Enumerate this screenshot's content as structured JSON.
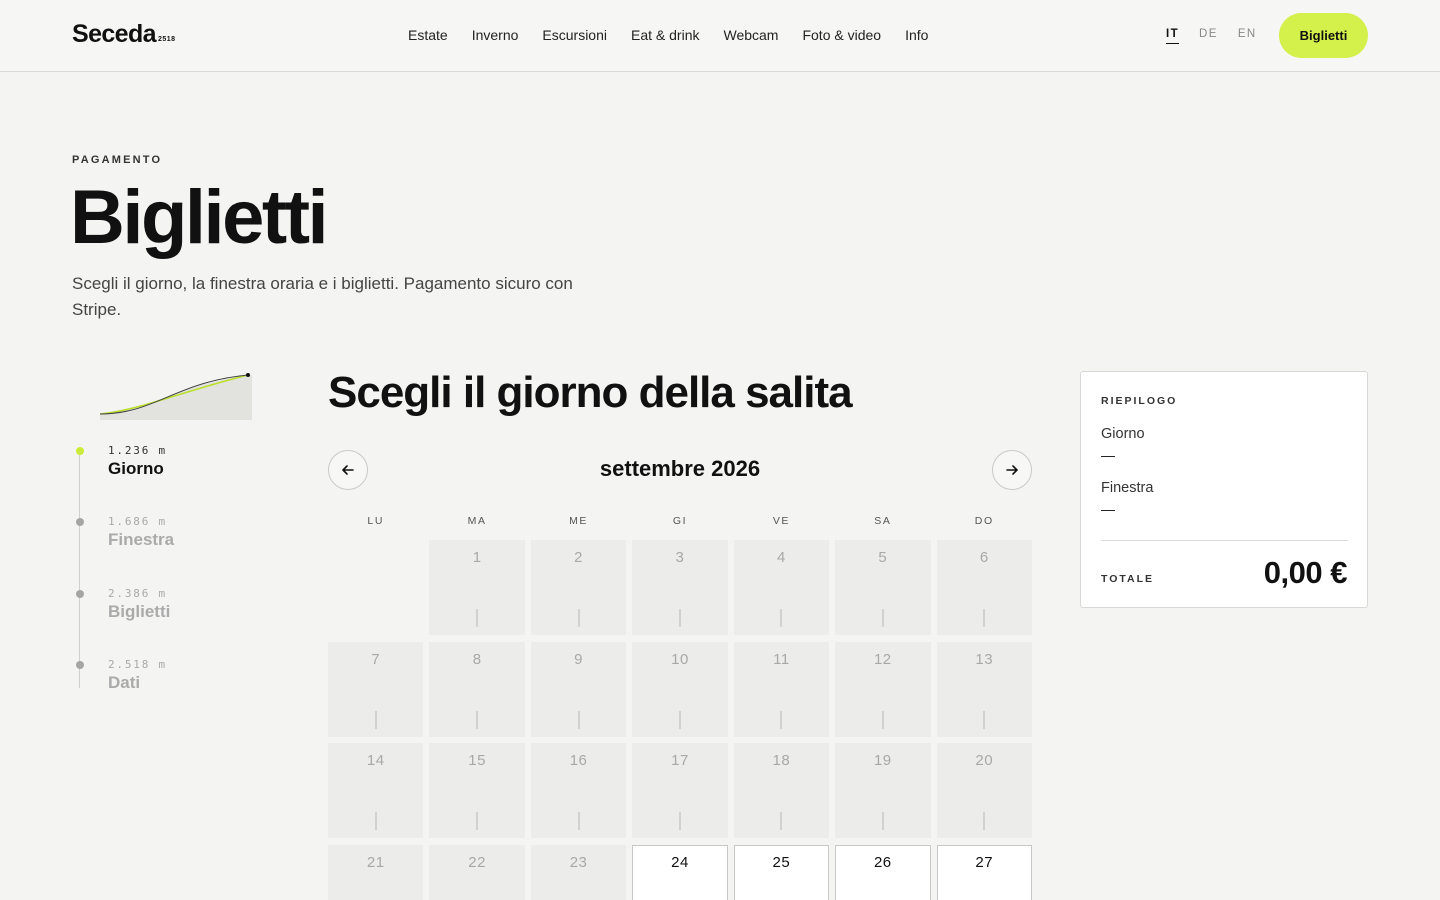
{
  "header": {
    "logo": "Seceda",
    "logo_sup": "2518",
    "nav": [
      "Estate",
      "Inverno",
      "Escursioni",
      "Eat & drink",
      "Webcam",
      "Foto & video",
      "Info"
    ],
    "langs": [
      "IT",
      "DE",
      "EN"
    ],
    "active_lang": "IT",
    "cta_label": "Biglietti"
  },
  "hero": {
    "eyebrow": "PAGAMENTO",
    "title": "Biglietti",
    "intro": "Scegli il giorno, la finestra oraria e i biglietti. Pagamento sicuro con Stripe."
  },
  "stepper": {
    "profile_icon": "elevation-profile",
    "steps": [
      {
        "altitude": "1.236 m",
        "label": "Giorno",
        "active": true
      },
      {
        "altitude": "1.686 m",
        "label": "Finestra",
        "active": false
      },
      {
        "altitude": "2.386 m",
        "label": "Biglietti",
        "active": false
      },
      {
        "altitude": "2.518 m",
        "label": "Dati",
        "active": false
      }
    ]
  },
  "calendar": {
    "title": "Scegli il giorno della salita",
    "month": "settembre 2026",
    "prev_icon": "arrow-left-icon",
    "next_icon": "arrow-right-icon",
    "weekdays": [
      "LU",
      "MA",
      "ME",
      "GI",
      "VE",
      "SA",
      "DO"
    ],
    "leading_empty": 1,
    "days": [
      {
        "n": "1",
        "available": false
      },
      {
        "n": "2",
        "available": false
      },
      {
        "n": "3",
        "available": false
      },
      {
        "n": "4",
        "available": false
      },
      {
        "n": "5",
        "available": false
      },
      {
        "n": "6",
        "available": false
      },
      {
        "n": "7",
        "available": false
      },
      {
        "n": "8",
        "available": false
      },
      {
        "n": "9",
        "available": false
      },
      {
        "n": "10",
        "available": false
      },
      {
        "n": "11",
        "available": false
      },
      {
        "n": "12",
        "available": false
      },
      {
        "n": "13",
        "available": false
      },
      {
        "n": "14",
        "available": false
      },
      {
        "n": "15",
        "available": false
      },
      {
        "n": "16",
        "available": false
      },
      {
        "n": "17",
        "available": false
      },
      {
        "n": "18",
        "available": false
      },
      {
        "n": "19",
        "available": false
      },
      {
        "n": "20",
        "available": false
      },
      {
        "n": "21",
        "available": false
      },
      {
        "n": "22",
        "available": false
      },
      {
        "n": "23",
        "available": false
      },
      {
        "n": "24",
        "available": true
      },
      {
        "n": "25",
        "available": true
      },
      {
        "n": "26",
        "available": true
      },
      {
        "n": "27",
        "available": true
      }
    ]
  },
  "summary": {
    "heading": "RIEPILOGO",
    "day_label": "Giorno",
    "day_value": "—",
    "window_label": "Finestra",
    "window_value": "—",
    "total_label": "TOTALE",
    "total_value": "0,00 €"
  },
  "colors": {
    "accent": "#d4f04a",
    "background": "#f4f4f3",
    "text": "#111111",
    "muted": "#a8a8a6"
  }
}
